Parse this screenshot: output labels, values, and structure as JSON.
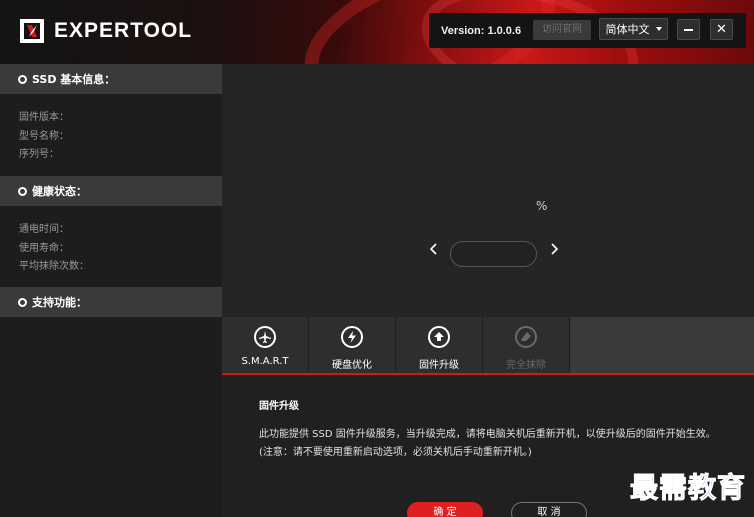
{
  "app": {
    "brand": "EXPERTOOL",
    "version_label": "Version: 1.0.0.6",
    "visit_site_label": "访问官网",
    "language_label": "简体中文"
  },
  "sidebar": {
    "sections": [
      {
        "title": "SSD 基本信息：",
        "fields": [
          "固件版本：",
          "型号名称：",
          "序列号："
        ]
      },
      {
        "title": "健康状态：",
        "fields": [
          "通电时间：",
          "使用寿命：",
          "平均抹除次数："
        ]
      },
      {
        "title": "支持功能：",
        "fields": []
      }
    ]
  },
  "main": {
    "percent_symbol": "%"
  },
  "tabs": [
    {
      "label": "S.M.A.R.T",
      "icon": "airplane-icon",
      "enabled": true
    },
    {
      "label": "硬盘优化",
      "icon": "lightning-icon",
      "enabled": true
    },
    {
      "label": "固件升级",
      "icon": "upload-icon",
      "enabled": true
    },
    {
      "label": "完全抹除",
      "icon": "eraser-icon",
      "enabled": false
    }
  ],
  "content": {
    "title": "固件升级",
    "description": "此功能提供 SSD 固件升级服务，当升级完成，请将电脑关机后重新开机，以使升级后的固件开始生效。(注意：请不要使用重新启动选项，必须关机后手动重新开机。)",
    "ok_label": "确 定",
    "cancel_label": "取 消"
  },
  "watermark": "最需教育",
  "colors": {
    "accent": "#e02020",
    "header_red": "#c81818",
    "sidebar_section_bg": "#3a3a3a"
  }
}
